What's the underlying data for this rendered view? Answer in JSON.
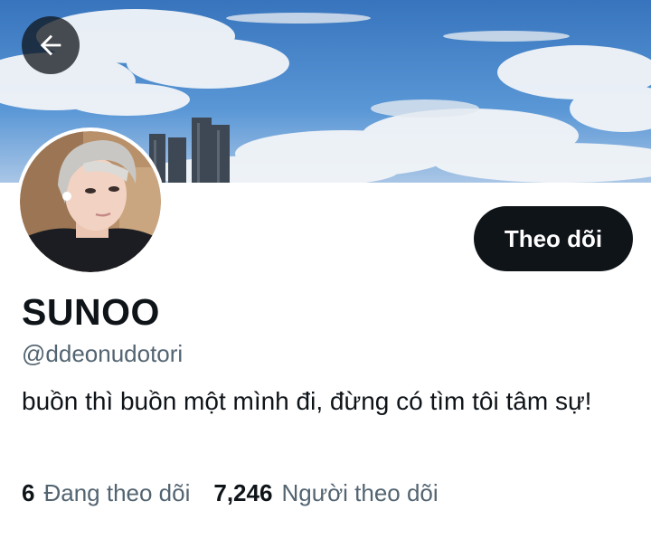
{
  "header": {
    "back_icon": "arrow-left-icon"
  },
  "profile": {
    "display_name": "SUNOO",
    "handle": "@ddeonudotori",
    "bio": "buồn thì buồn một mình đi, đừng có tìm tôi tâm sự!",
    "follow_button_label": "Theo dõi"
  },
  "stats": {
    "following_count": "6",
    "following_label": "Đang theo dõi",
    "followers_count": "7,246",
    "followers_label": "Người theo dõi"
  },
  "colors": {
    "primary_text": "#0f1419",
    "secondary_text": "#536471",
    "button_bg": "#0f1419",
    "button_text": "#ffffff"
  }
}
